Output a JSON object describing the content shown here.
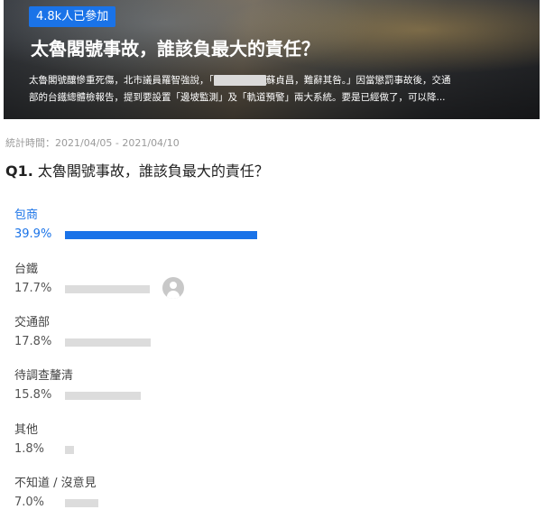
{
  "poll": {
    "participants_badge": "4.8k人已參加",
    "title": "太魯閣號事故，誰該負最大的責任？",
    "description_line1_a": "太魯閣號釀慘重死傷，北市議員羅智強說，「",
    "description_line1_b": "蘇貞昌，難辭其咎。」因當懲罰事故後，交通",
    "description_line2": "部的台鐵總體檢報告，提到要設置「邊坡監測」及「軌道預警」兩大系統。要是已經做了，可以降...",
    "period": "統計時間：2021/04/05 - 2021/04/10",
    "question_number": "Q1.",
    "question_text": "太魯閣號事故，誰該負最大的責任？",
    "options": [
      {
        "label": "包商",
        "percent_text": "39.9%",
        "percent": 39.9,
        "selected": true
      },
      {
        "label": "台鐵",
        "percent_text": "17.7%",
        "percent": 17.7,
        "selected": false
      },
      {
        "label": "交通部",
        "percent_text": "17.8%",
        "percent": 17.8,
        "selected": false
      },
      {
        "label": "待調查釐清",
        "percent_text": "15.8%",
        "percent": 15.8,
        "selected": false
      },
      {
        "label": "其他",
        "percent_text": "1.8%",
        "percent": 1.8,
        "selected": false
      },
      {
        "label": "不知道 / 沒意見",
        "percent_text": "7.0%",
        "percent": 7.0,
        "selected": false
      }
    ]
  },
  "colors": {
    "accent": "#1a73e8",
    "bar_default": "#dcdcdc",
    "muted_text": "#9a9a9a"
  },
  "icons": {
    "voter_avatar": "user-avatar-icon"
  }
}
